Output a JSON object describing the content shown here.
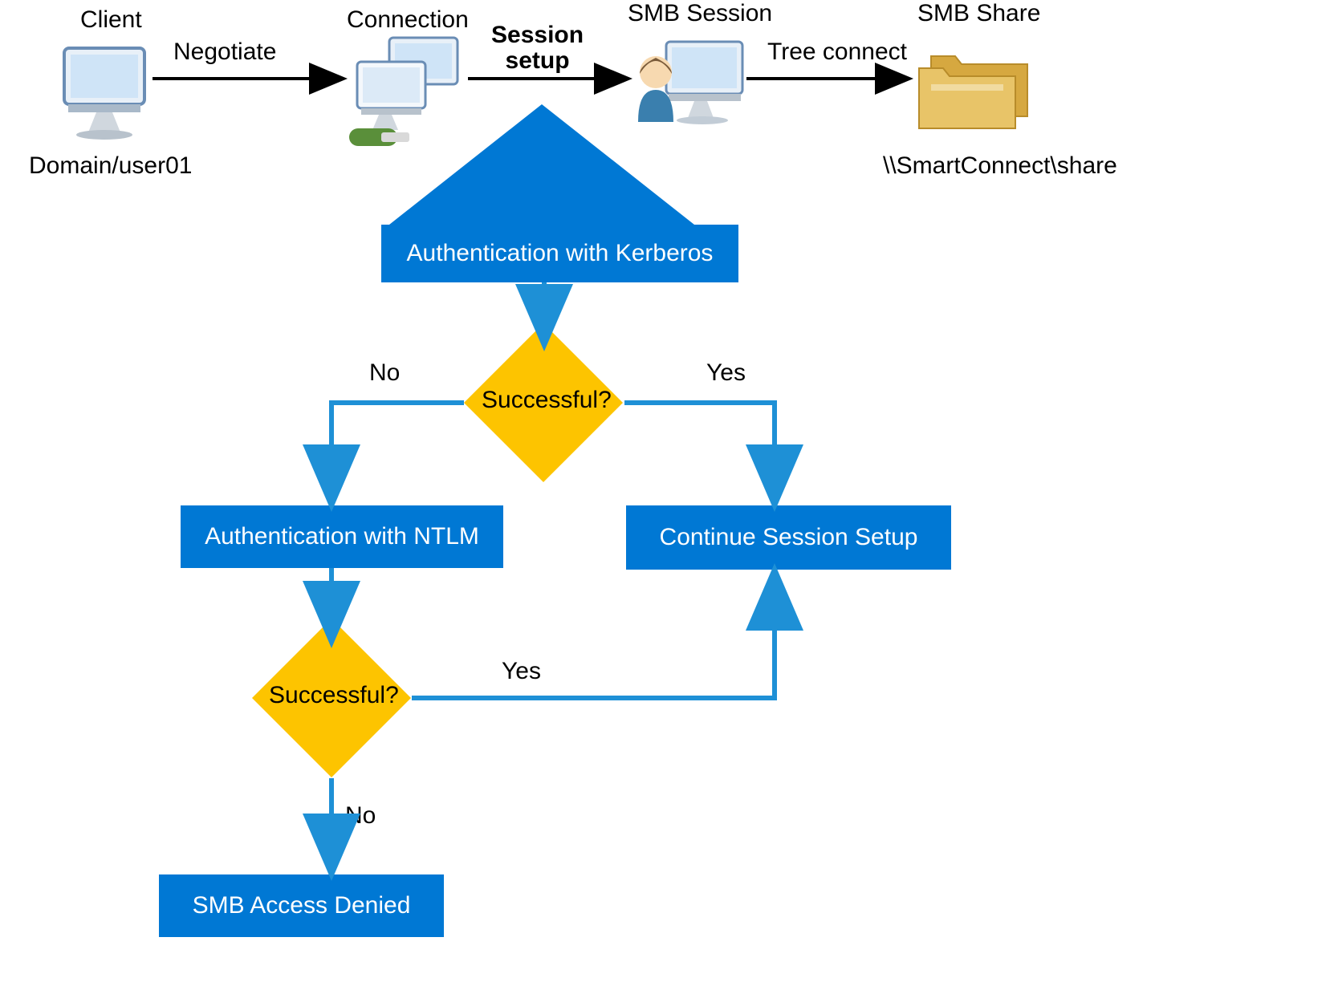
{
  "header": {
    "client": "Client",
    "connection": "Connection",
    "smb_session": "SMB Session",
    "smb_share": "SMB Share",
    "negotiate": "Negotiate",
    "session_setup": "Session setup",
    "tree_connect": "Tree connect",
    "domain_user": "Domain/user01",
    "share_path": "\\\\SmartConnect\\share"
  },
  "flow": {
    "auth_kerberos": "Authentication with Kerberos",
    "successful1": "Successful?",
    "no1": "No",
    "yes1": "Yes",
    "auth_ntlm": "Authentication with NTLM",
    "continue_session": "Continue Session Setup",
    "successful2": "Successful?",
    "yes2": "Yes",
    "no2": "No",
    "access_denied": "SMB Access Denied"
  },
  "colors": {
    "blue": "#0078d4",
    "yellow": "#fdc400",
    "arrow_blue": "#1e90d6"
  }
}
